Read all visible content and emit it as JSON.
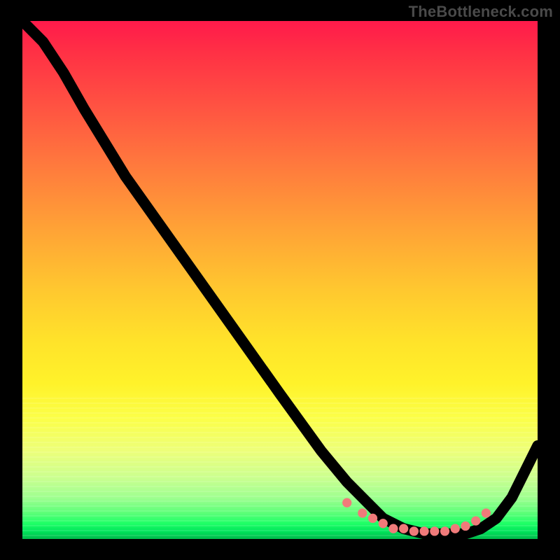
{
  "watermark": "TheBottleneck.com",
  "colors": {
    "dot": "#f07a7a",
    "curve": "#000000"
  },
  "chart_data": {
    "type": "line",
    "title": "",
    "xlabel": "",
    "ylabel": "",
    "xlim": [
      0,
      100
    ],
    "ylim": [
      0,
      100
    ],
    "series": [
      {
        "name": "curve",
        "x": [
          0,
          4,
          8,
          12,
          20,
          30,
          40,
          50,
          58,
          63,
          67,
          70,
          74,
          78,
          82,
          86,
          89,
          92,
          95,
          100
        ],
        "y": [
          100,
          96,
          90,
          83,
          70,
          56,
          42,
          28,
          17,
          11,
          7,
          4,
          2,
          1,
          1,
          1,
          2,
          4,
          8,
          18
        ]
      }
    ],
    "bottom_dots": {
      "name": "flat-region-markers",
      "x": [
        63,
        66,
        68,
        70,
        72,
        74,
        76,
        78,
        80,
        82,
        84,
        86,
        88,
        90
      ],
      "y": [
        7,
        5,
        4,
        3,
        2,
        2,
        1.5,
        1.5,
        1.5,
        1.5,
        2,
        2.5,
        3.5,
        5
      ]
    }
  }
}
